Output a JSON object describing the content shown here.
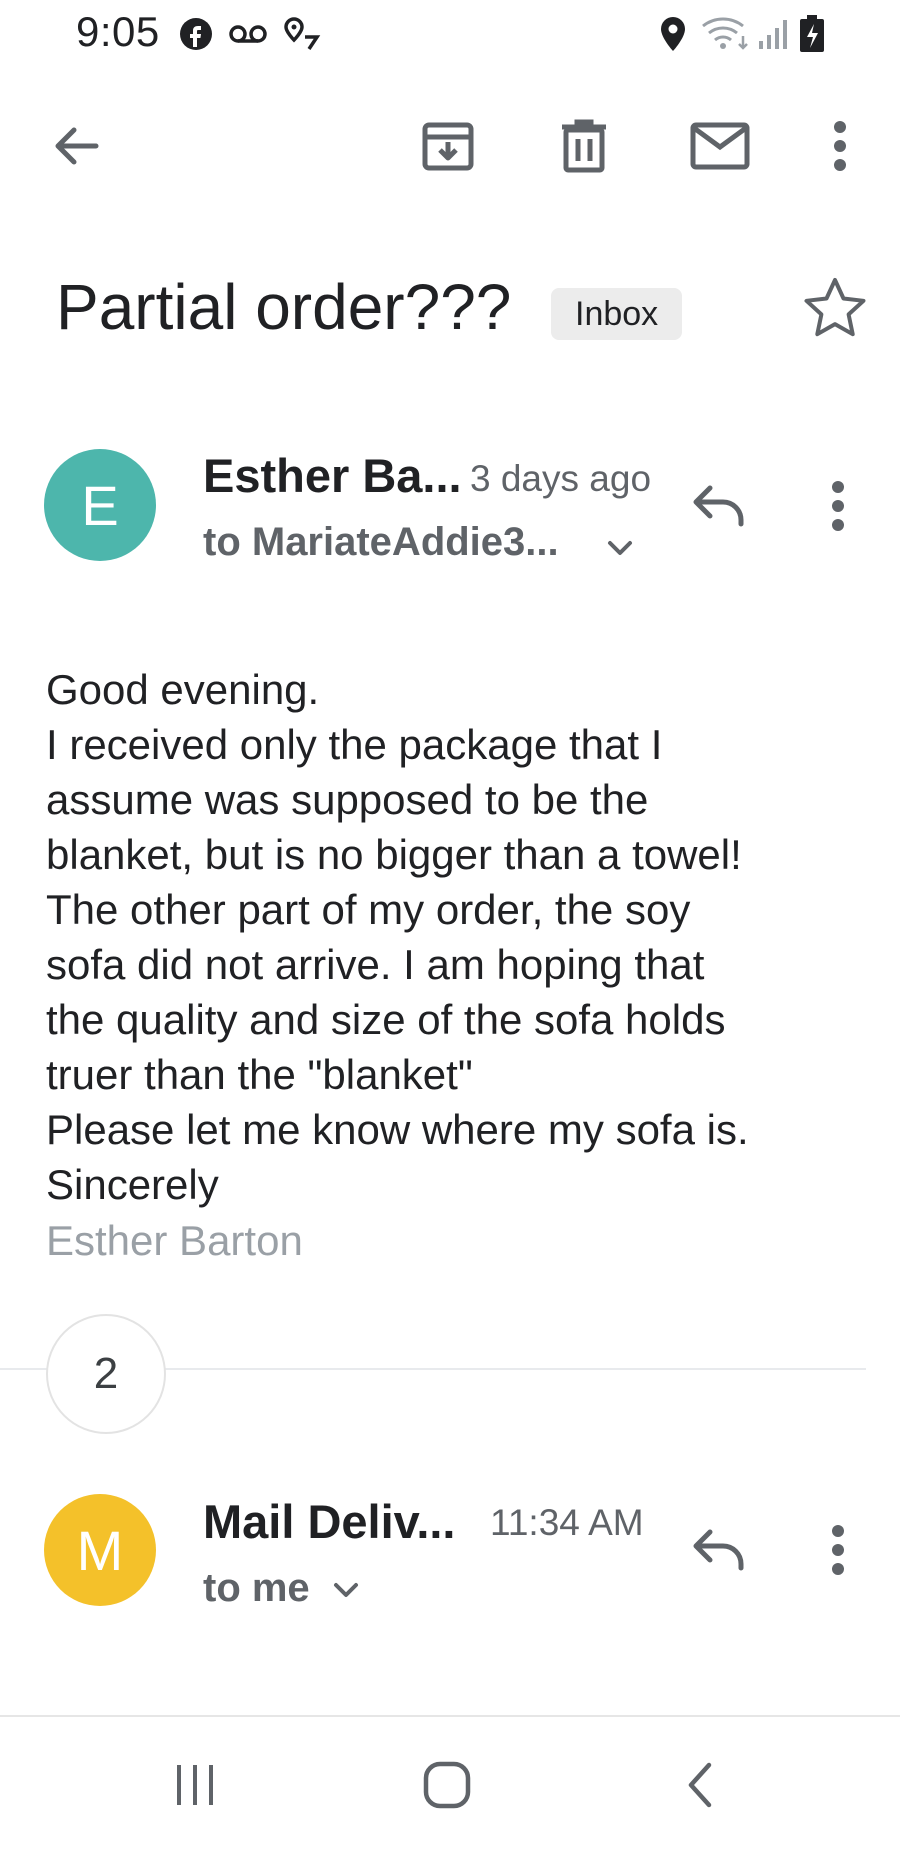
{
  "status_bar": {
    "time": "9:05",
    "icons": [
      "facebook-icon",
      "voicemail-icon",
      "location-off-icon",
      "location-icon",
      "wifi-icon",
      "signal-icon",
      "battery-charging-icon"
    ]
  },
  "toolbar": {
    "actions": [
      "back-icon",
      "archive-icon",
      "delete-icon",
      "mark-unread-icon",
      "more-options-icon"
    ]
  },
  "email": {
    "subject": "Partial order???",
    "label": "Inbox",
    "starred": false
  },
  "messages": [
    {
      "avatar_letter": "E",
      "avatar_color": "#4db6ac",
      "sender": "Esther Ba...",
      "time": "3 days ago",
      "recipient": "to MariateAddie3...",
      "body": [
        "Good evening.",
        "I received only the package that I",
        "assume was supposed to be the",
        "blanket, but is no bigger than a towel!",
        "The other part of my order, the soy",
        "sofa did not arrive.  I am hoping that",
        "the quality and size of the sofa holds",
        "truer than the \"blanket\"",
        "Please let me know where my sofa is.",
        "Sincerely"
      ],
      "signature": "Esther Barton"
    },
    {
      "avatar_letter": "M",
      "avatar_color": "#f4c12a",
      "sender": "Mail Deliv...",
      "time": "11:34 AM",
      "recipient": "to me"
    }
  ],
  "collapsed_count": "2",
  "colors": {
    "text_primary": "#202124",
    "text_secondary": "#5f6368",
    "icon": "#5f6368"
  },
  "nav_bar": {
    "buttons": [
      "recent-apps-icon",
      "home-icon",
      "back-nav-icon"
    ]
  }
}
